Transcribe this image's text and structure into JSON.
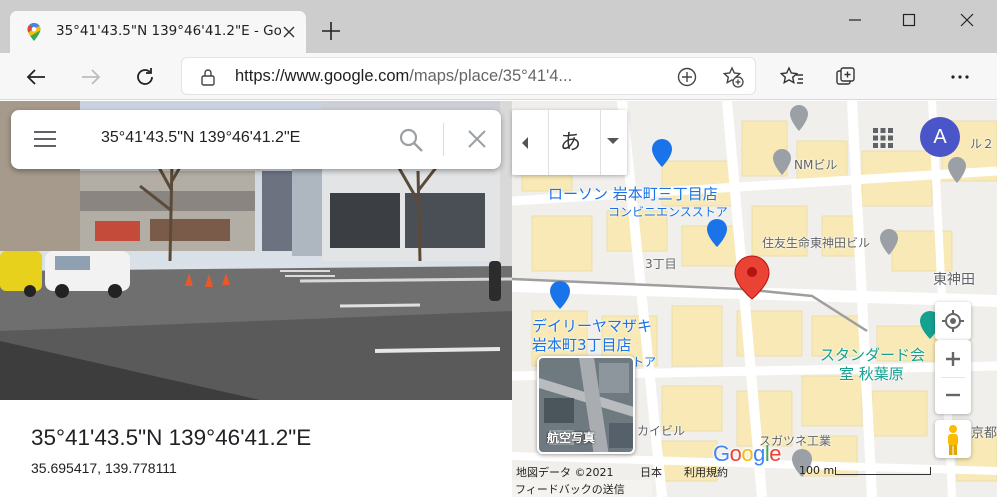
{
  "browser": {
    "tab_title": "35°41'43.5\"N 139°46'41.2\"E - Google Maps",
    "url_host": "https://www.google.com",
    "url_path": "/maps/place/35°41'4..."
  },
  "search": {
    "query": "35°41'43.5\"N 139°46'41.2\"E"
  },
  "place": {
    "title": "35°41'43.5\"N 139°46'41.2\"E",
    "decimal": "35.695417, 139.778111"
  },
  "map": {
    "ime_char": "あ",
    "avatar_letter": "A",
    "labels": {
      "nm_building": "NMビル",
      "lawson_name": "ローソン 岩本町三丁目店",
      "lawson_sub": "コンビニエンスストア",
      "sumitomo": "住友生命東神田ビル",
      "chome3": "3丁目",
      "higashikanda": "東神田",
      "daily_1": "デイリーヤマザキ",
      "daily_2": "岩本町3丁目店",
      "daily_3": "ストア",
      "standard_1": "スタンダード会",
      "standard_2": "室 秋葉原",
      "kaibiru": "カイビル",
      "sugatsune": "スガツネ工業",
      "kyoto": "京都",
      "ru2": "ル２"
    },
    "aerial_label": "航空写真",
    "footer": {
      "map_data": "地図データ ©2021",
      "japan": "日本",
      "terms": "利用規約",
      "scale": "100 m",
      "feedback": "フィードバックの送信"
    },
    "colors": {
      "pin": "#ea4335",
      "road": "#ffffff",
      "building": "#f8e9b6",
      "block": "#eceae6",
      "poi_blue": "#1a73e8",
      "poi_teal": "#15a090"
    }
  }
}
